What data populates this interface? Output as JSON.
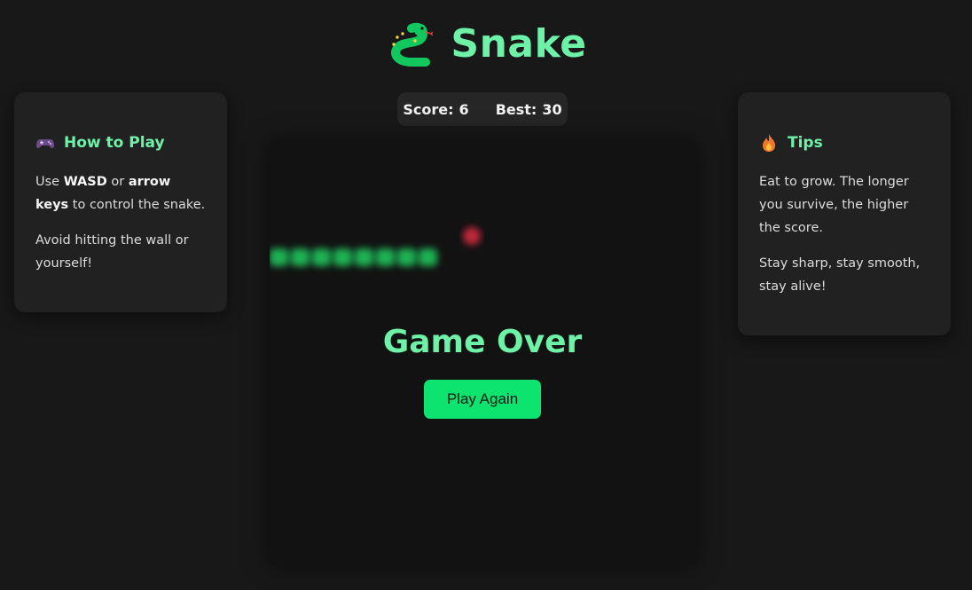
{
  "app": {
    "title": "Snake",
    "icon": "snake-icon",
    "accent_color": "#6ef2a8",
    "button_color": "#0de36f"
  },
  "scoreboard": {
    "score_label": "Score:",
    "score_value": "6",
    "best_label": "Best:",
    "best_value": "30"
  },
  "how_to_play": {
    "icon": "gamepad-icon",
    "heading": "How to Play",
    "line1_a": "Use ",
    "line1_key1": "WASD",
    "line1_b": " or ",
    "line1_key2": "arrow keys",
    "line1_c": " to control the snake.",
    "line2": "Avoid hitting the wall or yourself!"
  },
  "tips": {
    "icon": "fire-icon",
    "heading": "Tips",
    "line1": "Eat to grow. The longer you survive, the higher the score.",
    "line2": "Stay sharp, stay smooth, stay alive!"
  },
  "game": {
    "state": "game-over",
    "overlay_title": "Game Over",
    "play_again_label": "Play Again",
    "snake_color": "#1fb052",
    "food_color": "#c0283a",
    "snake_length": 8
  }
}
